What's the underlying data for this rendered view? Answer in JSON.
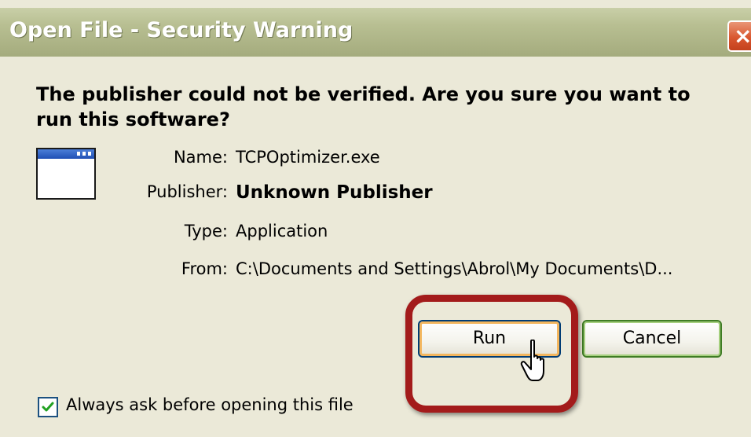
{
  "window": {
    "title": "Open File - Security Warning",
    "close_glyph": "×"
  },
  "heading": "The publisher could not be verified.  Are you sure you want to run this software?",
  "icon": "application-window-icon",
  "fields": {
    "name_label": "Name:",
    "name_value": "TCPOptimizer.exe",
    "publisher_label": "Publisher:",
    "publisher_value": "Unknown Publisher",
    "type_label": "Type:",
    "type_value": "Application",
    "from_label": "From:",
    "from_value": "C:\\Documents and Settings\\Abrol\\My Documents\\D..."
  },
  "buttons": {
    "run_label": "Run",
    "cancel_label": "Cancel"
  },
  "checkbox": {
    "label": "Always ask before opening this file",
    "checked": true
  },
  "colors": {
    "highlight": "#a31b1b",
    "title_bar": "#b8bf92",
    "dialog_bg": "#ebe9d8"
  }
}
